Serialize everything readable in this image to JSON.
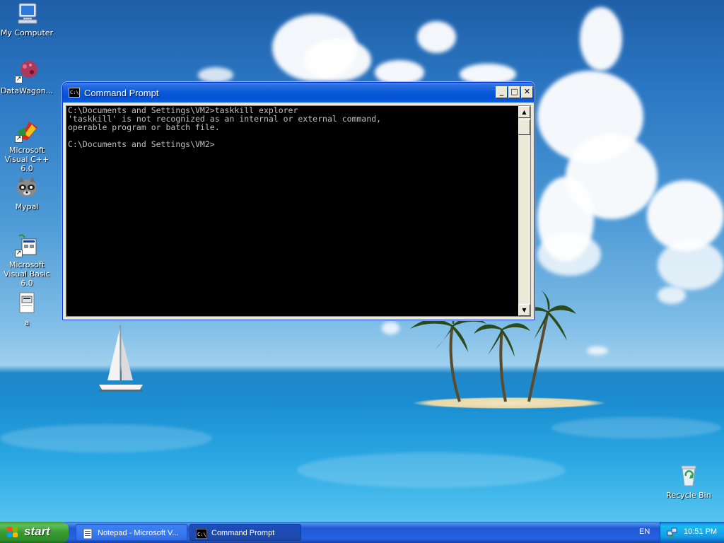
{
  "desktop": {
    "icons": [
      {
        "label": "My Computer"
      },
      {
        "label": "DataWagon..."
      },
      {
        "label": "Microsoft Visual C++ 6.0"
      },
      {
        "label": "Mypal"
      },
      {
        "label": "Microsoft Visual Basic 6.0"
      },
      {
        "label": "a"
      },
      {
        "label": "Recycle Bin"
      }
    ]
  },
  "cmd_window": {
    "title": "Command Prompt",
    "title_icon_text": "C:\\",
    "buttons": {
      "minimize": "_",
      "maximize": "□",
      "close": "✕"
    },
    "console_text": "C:\\Documents and Settings\\VM2>taskkill explorer\n'taskkill' is not recognized as an internal or external command,\noperable program or batch file.\n\nC:\\Documents and Settings\\VM2>"
  },
  "taskbar": {
    "start_label": "start",
    "tasks": [
      {
        "label": "Notepad - Microsoft V...",
        "state": "inactive"
      },
      {
        "label": "Command Prompt",
        "state": "active"
      }
    ],
    "language": "EN",
    "clock": "10:51 PM"
  },
  "colors": {
    "titlebar": "#0551d4",
    "console_bg": "#000000",
    "console_fg": "#c0c0c0",
    "taskbar": "#2457d2",
    "start_green": "#379b30"
  }
}
